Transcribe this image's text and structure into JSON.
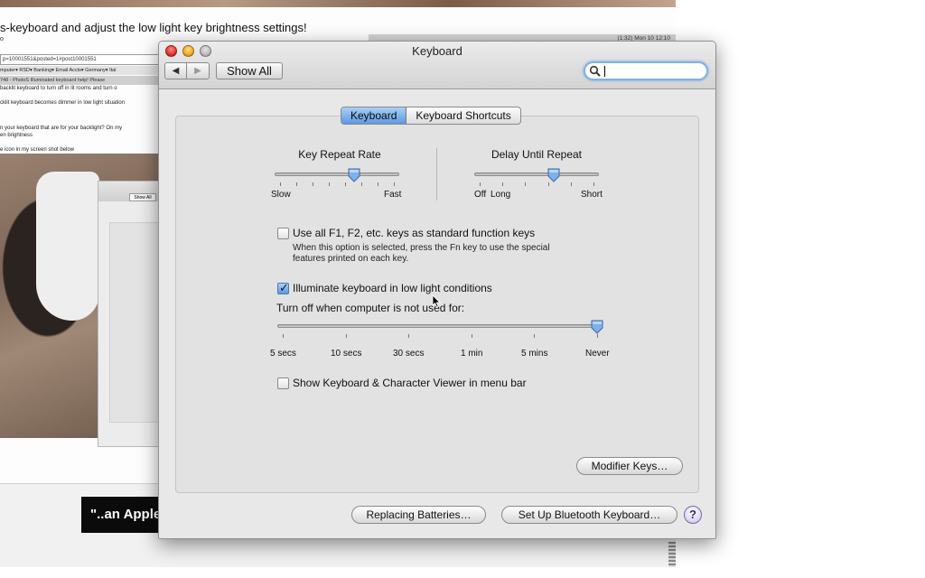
{
  "background_page": {
    "headline": "s-keyboard and adjust the low light key brightness settings!",
    "url_fragment": "o",
    "address_bar": "p=10001551&posted=1#post10001551",
    "bookmarks": "mputer▾   RSD▾   Banking▾   Email Accts▾   Germany▾   Ital",
    "tabs": "748 - PhotoS      Illuminated keyboard help! Please",
    "post_lines": [
      "backlit keyboard to turn off in lit rooms and turn o",
      "cklit keyboard becomes dimmer in low light situation",
      "n your keyboard that are for your backlight? On my",
      "en brightness",
      "e icon in my screen shot below"
    ],
    "inner_window_show_all": "Show All",
    "apple_banner": "\"..an Apple",
    "menubar_text": "(1:32)  Mon 10  12:10"
  },
  "window": {
    "title": "Keyboard",
    "nav_back": "◀",
    "nav_forward": "▶",
    "show_all": "Show All",
    "search": {
      "value": "",
      "placeholder": ""
    }
  },
  "tabs": {
    "keyboard": "Keyboard",
    "shortcuts": "Keyboard Shortcuts"
  },
  "key_repeat": {
    "title": "Key Repeat Rate",
    "min_label": "Slow",
    "max_label": "Fast",
    "value_fraction": 0.65
  },
  "delay_repeat": {
    "title": "Delay Until Repeat",
    "off_label": "Off",
    "min_label": "Long",
    "max_label": "Short",
    "value_fraction": 0.65
  },
  "function_keys": {
    "label": "Use all F1, F2, etc. keys as standard function keys",
    "checked": false,
    "help_line_1": "When this option is selected, press the Fn key to use the special",
    "help_line_2": "features printed on each key."
  },
  "illuminate": {
    "label": "Illuminate keyboard in low light conditions",
    "checked": true,
    "turn_off_label": "Turn off when computer is not used for:",
    "ticks": [
      "5 secs",
      "10 secs",
      "30 secs",
      "1 min",
      "5 mins",
      "Never"
    ],
    "value_fraction": 1.0
  },
  "viewer": {
    "label": "Show Keyboard & Character Viewer in menu bar",
    "checked": false
  },
  "buttons": {
    "modifier_keys": "Modifier Keys…",
    "replacing_batteries": "Replacing Batteries…",
    "bluetooth": "Set Up Bluetooth Keyboard…",
    "help": "?"
  },
  "colors": {
    "accent": "#5d98e0",
    "close": "#e0322a",
    "minimize": "#f0a923"
  }
}
